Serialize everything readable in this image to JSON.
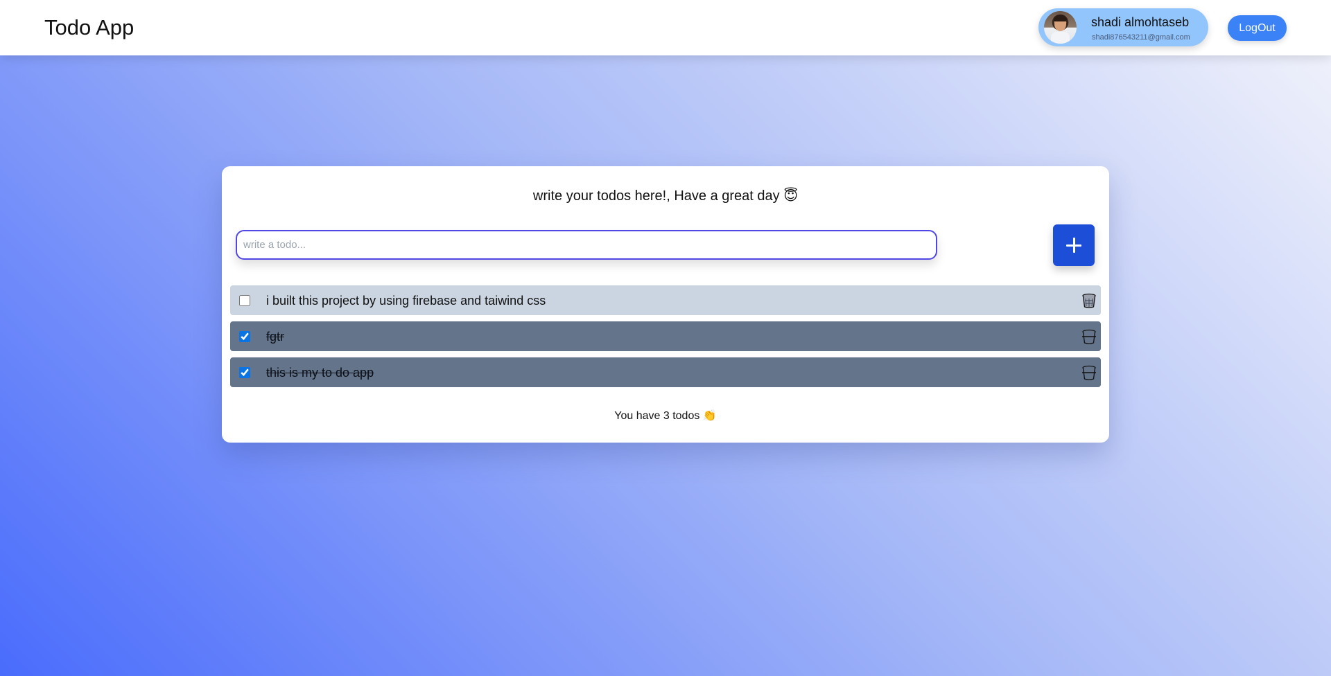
{
  "header": {
    "title": "Todo App",
    "user": {
      "name": "shadi almohtaseb",
      "email": "shadi876543211@gmail.com"
    },
    "logout_label": "LogOut"
  },
  "main": {
    "greeting": "write your todos here!, Have a great day 😇",
    "input": {
      "placeholder": "write a todo...",
      "value": ""
    },
    "add_button_icon": "plus-icon",
    "todos": [
      {
        "text": "i built this project by using firebase and taiwind css",
        "completed": false
      },
      {
        "text": "fgtr",
        "completed": true
      },
      {
        "text": "this is my to do app",
        "completed": true
      }
    ],
    "count_text": "You have 3 todos 👏"
  },
  "colors": {
    "accent": "#1d4ed8",
    "logout": "#3b82f6",
    "user_pill": "#93c5fd",
    "todo_pending": "#cbd5e1",
    "todo_done": "#64748b",
    "input_border": "#4f46e5"
  }
}
